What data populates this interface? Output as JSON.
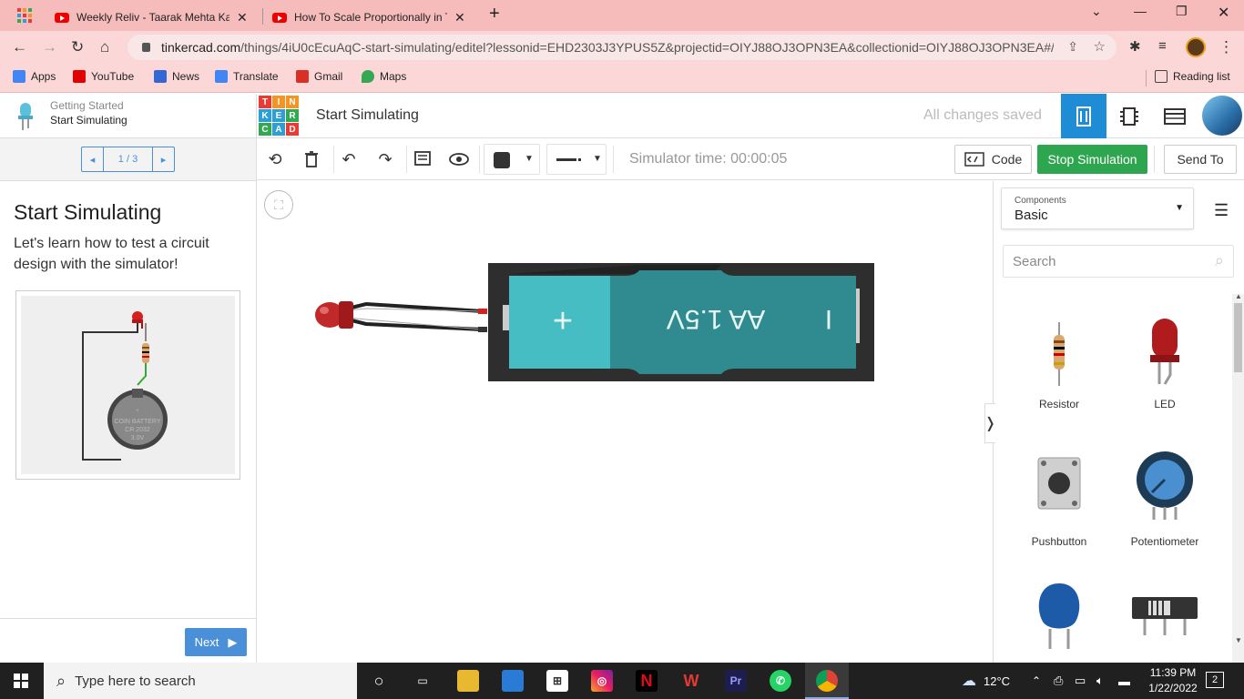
{
  "browser": {
    "tabs": [
      {
        "title": "Weekly Reliv - Taarak Mehta Ka C"
      },
      {
        "title": "How To Scale Proportionally in Ti"
      }
    ],
    "url_domain": "tinkercad.com",
    "url_path": "/things/4iU0cEcuAqC-start-simulating/editel?lessonid=EHD2303J3YPUS5Z&projectid=OIYJ88OJ3OPN3EA&collectionid=OIYJ88OJ3OPN3EA#/le...",
    "bookmarks": [
      {
        "label": "Apps",
        "color": "#4285f4"
      },
      {
        "label": "YouTube",
        "color": "#e00000"
      },
      {
        "label": "News",
        "color": "#3367d6"
      },
      {
        "label": "Translate",
        "color": "#4285f4"
      },
      {
        "label": "Gmail",
        "color": "#d93025"
      },
      {
        "label": "Maps",
        "color": "#34a853"
      }
    ],
    "reading_list": "Reading list"
  },
  "lesson": {
    "crumb_top": "Getting Started",
    "crumb_bottom": "Start Simulating",
    "pager": "1 / 3",
    "title": "Start Simulating",
    "body": "Let's learn how to test a circuit design with the simulator!",
    "preview_battery_text": "COIN BATTERY",
    "preview_battery_model": "CR 2032",
    "preview_battery_volt": "3.0V",
    "next": "Next"
  },
  "editor": {
    "logo_letters": [
      "T",
      "I",
      "N",
      "K",
      "E",
      "R",
      "C",
      "A",
      "D"
    ],
    "logo_colors": [
      "#e93a33",
      "#f59423",
      "#f59423",
      "#2e9fd5",
      "#2e9fd5",
      "#33a853",
      "#33a853",
      "#2e9fd5",
      "#e93a33"
    ],
    "design_title": "Start Simulating",
    "save_status": "All changes saved",
    "simulator_time": "Simulator time: 00:00:05",
    "code_label": "Code",
    "stop_label": "Stop Simulation",
    "send_to_label": "Send To",
    "accent": "#1f8dd6",
    "stop_color": "#2ea64f"
  },
  "circuit": {
    "battery_label": "AA 1.5V",
    "battery_plus": "+",
    "battery_minus": "I"
  },
  "components": {
    "group_label": "Components",
    "group_value": "Basic",
    "search_placeholder": "Search",
    "items": [
      {
        "label": "Resistor"
      },
      {
        "label": "LED"
      },
      {
        "label": "Pushbutton"
      },
      {
        "label": "Potentiometer"
      }
    ]
  },
  "taskbar": {
    "search_placeholder": "Type here to search",
    "weather": "12°C",
    "time": "11:39 PM",
    "date": "1/22/2022",
    "notifications": "2"
  }
}
